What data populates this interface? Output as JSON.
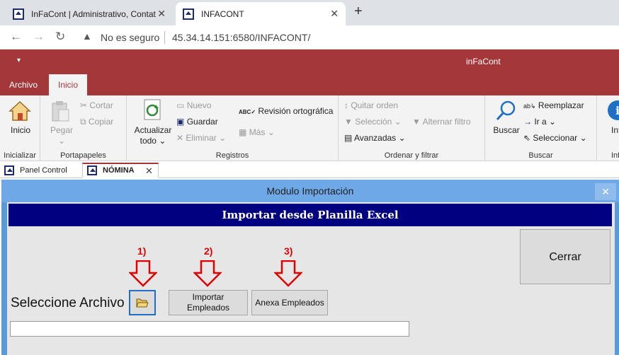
{
  "browser": {
    "tabs": [
      {
        "label": "InFaCont | Administrativo, Contat"
      },
      {
        "label": "INFACONT"
      }
    ],
    "security_text": "No es seguro",
    "url": "45.34.14.151:6580/INFACONT/"
  },
  "app": {
    "title": "inFaCont",
    "ribbon_tabs": [
      "Archivo",
      "Inicio"
    ]
  },
  "ribbon": {
    "groups": {
      "inicializar": {
        "label": "Inicializar",
        "inicio": "Inicio"
      },
      "portapapeles": {
        "label": "Portapapeles",
        "pegar": "Pegar",
        "cortar": "Cortar",
        "copiar": "Copiar"
      },
      "registros": {
        "label": "Registros",
        "actualizar": "Actualizar",
        "todo": "todo",
        "nuevo": "Nuevo",
        "guardar": "Guardar",
        "eliminar": "Eliminar",
        "revision": "Revisión ortográfica",
        "mas": "Más"
      },
      "ordenar": {
        "label": "Ordenar y filtrar",
        "quitar": "Quitar orden",
        "seleccion": "Selección",
        "alternar": "Alternar filtro",
        "avanzadas": "Avanzadas"
      },
      "buscar": {
        "label": "Buscar",
        "buscar": "Buscar",
        "reemplazar": "Reemplazar",
        "ira": "Ir a",
        "seleccionar": "Seleccionar"
      },
      "extra": {
        "label": "Inf",
        "item": "Inf"
      }
    }
  },
  "object_tabs": [
    {
      "label": "Panel Control"
    },
    {
      "label": "NÓMINA"
    }
  ],
  "form": {
    "window_title": "Modulo Importación",
    "header": "Importar desde Planilla Excel",
    "close_button": "Cerrar",
    "select_label": "Seleccione Archivo",
    "import_button": "Importar Empleados",
    "annex_button": "Anexa Empleados",
    "steps": [
      "1)",
      "2)",
      "3)"
    ],
    "file_path": ""
  },
  "colors": {
    "accent": "#a4373a",
    "header_bg": "#000080",
    "step_red": "#e00000",
    "form_blue": "#5b9bd5"
  }
}
